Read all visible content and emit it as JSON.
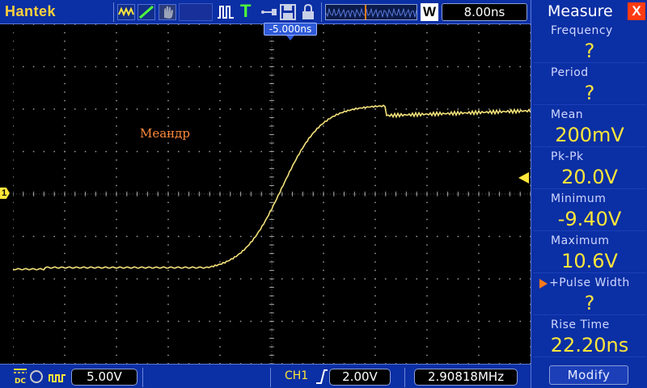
{
  "topbar": {
    "brand": "Hantek",
    "trigger_mode_letter": "T",
    "zoom_mode_letter": "W",
    "timebase": "8.00ns",
    "timeline_marker_fraction": 0.42
  },
  "screen": {
    "trigger_position": "-5.000ns",
    "channel_marker": "1",
    "annotation": "Меандр",
    "trace_color": "#f4e27a",
    "graticule_color": "#9a9a9a"
  },
  "bottombar": {
    "coupling_label": "DC",
    "ch1_volts_div": "5.00V",
    "trigger_source": "CH1",
    "trigger_level": "2.00V",
    "frequency": "2.90818MHz"
  },
  "measure": {
    "title": "Measure",
    "close_symbol": "X",
    "items": [
      {
        "label": "Frequency",
        "value": "?"
      },
      {
        "label": "Period",
        "value": "?"
      },
      {
        "label": "Mean",
        "value": "200mV"
      },
      {
        "label": "Pk-Pk",
        "value": "20.0V"
      },
      {
        "label": "Minimum",
        "value": "-9.40V"
      },
      {
        "label": "Maximum",
        "value": "10.6V"
      },
      {
        "label": "+Pulse Width",
        "value": "?"
      },
      {
        "label": "Rise Time",
        "value": "22.20ns"
      }
    ],
    "selected_index": 6,
    "modify_label": "Modify"
  },
  "colors": {
    "panel_blue": "#0b2fa4",
    "accent_yellow": "#ffe63a",
    "brand_yellow": "#ffd23a",
    "trigger_blue": "#2f5ad8",
    "close_red": "#ff3b12",
    "selection_orange": "#ff7a1a"
  }
}
